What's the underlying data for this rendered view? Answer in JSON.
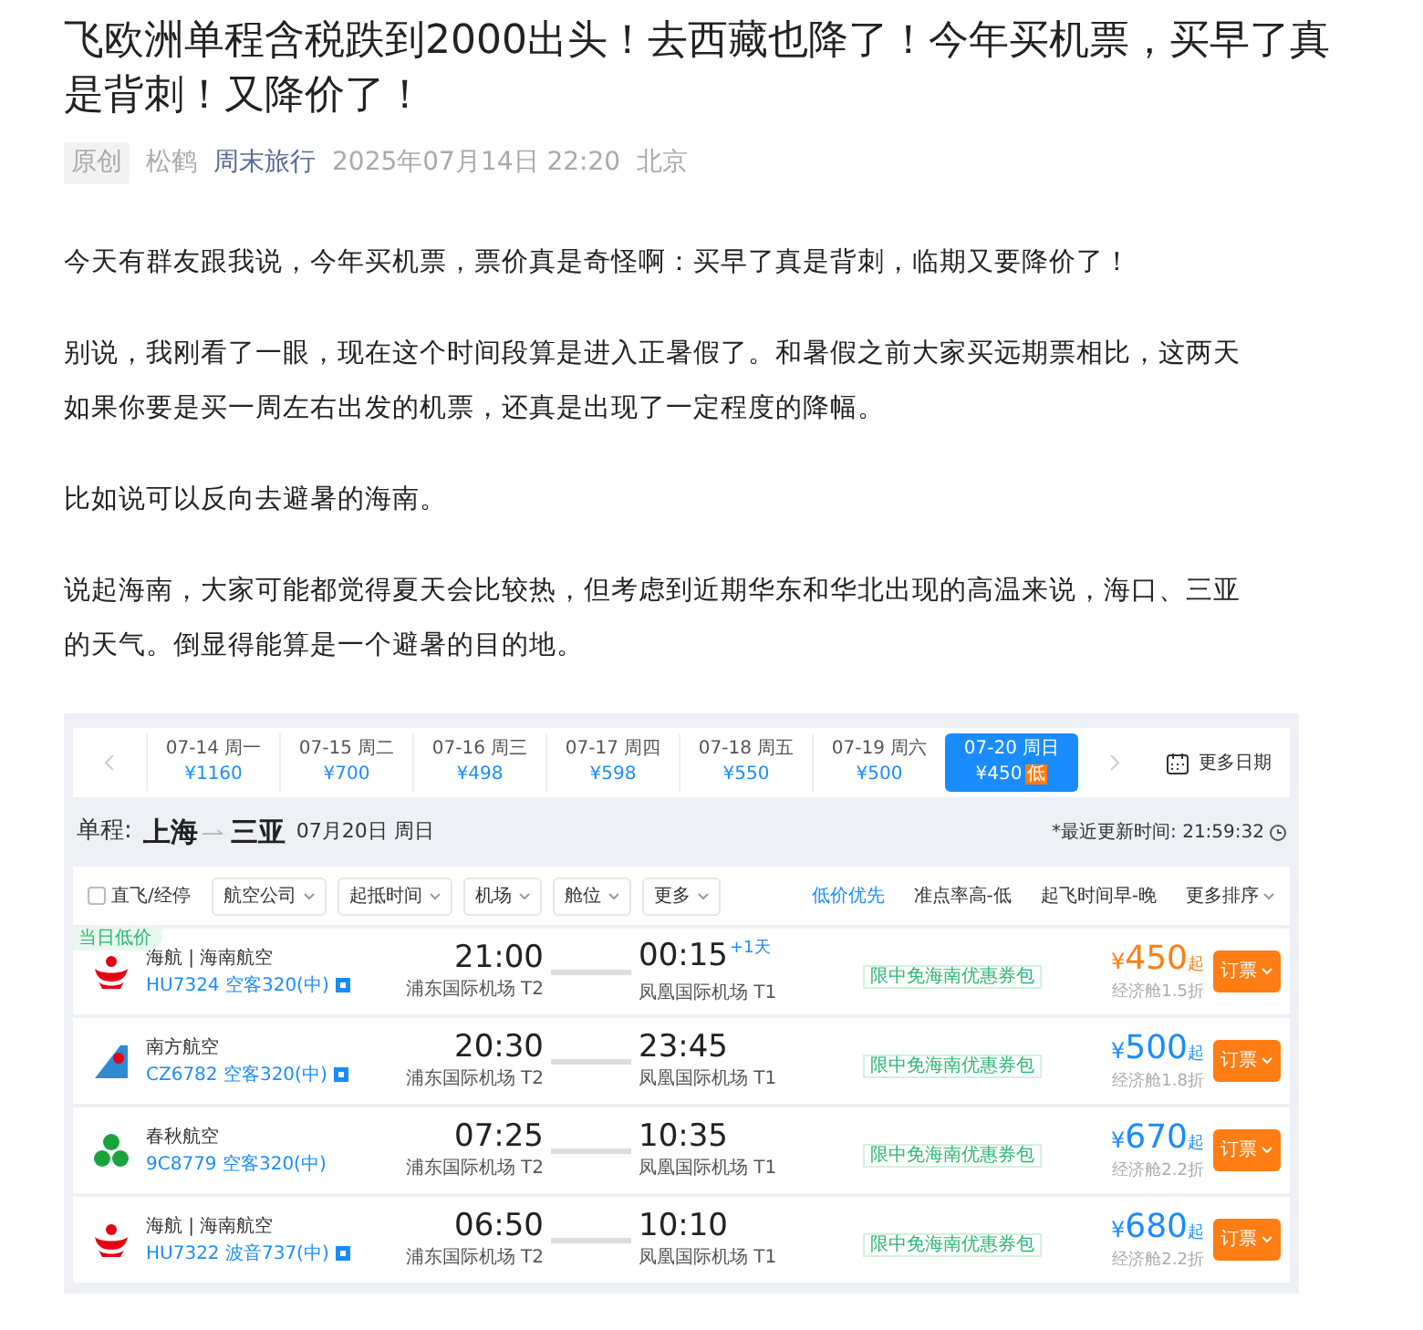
{
  "article": {
    "title": "飞欧洲单程含税跌到2000出头！去西藏也降了！今年买机票，买早了真是背刺！又降价了！",
    "meta": {
      "badge": "原创",
      "author": "松鹤",
      "column": "周末旅行",
      "datetime": "2025年07月14日 22:20",
      "location": "北京"
    },
    "paragraphs": [
      "今天有群友跟我说，今年买机票，票价真是奇怪啊：买早了真是背刺，临期又要降价了！",
      "别说，我刚看了一眼，现在这个时间段算是进入正暑假了。和暑假之前大家买远期票相比，这两天如果你要是买一周左右出发的机票，还真是出现了一定程度的降幅。",
      "比如说可以反向去避暑的海南。",
      "说起海南，大家可能都觉得夏天会比较热，但考虑到近期华东和华北出现的高温来说，海口、三亚的天气。倒显得能算是一个避暑的目的地。"
    ]
  },
  "flight_app": {
    "dates": [
      {
        "date": "07-14",
        "weekday": "周一",
        "price": "¥1160",
        "selected": false
      },
      {
        "date": "07-15",
        "weekday": "周二",
        "price": "¥700",
        "selected": false
      },
      {
        "date": "07-16",
        "weekday": "周三",
        "price": "¥498",
        "selected": false
      },
      {
        "date": "07-17",
        "weekday": "周四",
        "price": "¥598",
        "selected": false
      },
      {
        "date": "07-18",
        "weekday": "周五",
        "price": "¥550",
        "selected": false
      },
      {
        "date": "07-19",
        "weekday": "周六",
        "price": "¥500",
        "selected": false
      },
      {
        "date": "07-20",
        "weekday": "周日",
        "price": "¥450",
        "selected": true,
        "badge": "低"
      }
    ],
    "more_dates": "更多日期",
    "route": {
      "label": "单程:",
      "from": "上海",
      "to": "三亚",
      "date": "07月20日 周日",
      "updated": "*最近更新时间: 21:59:32"
    },
    "filters": [
      {
        "label": "直飞/经停",
        "kind": "checkbox",
        "checked": false
      },
      {
        "label": "航空公司",
        "kind": "dropdown"
      },
      {
        "label": "起抵时间",
        "kind": "dropdown"
      },
      {
        "label": "机场",
        "kind": "dropdown"
      },
      {
        "label": "舱位",
        "kind": "dropdown"
      },
      {
        "label": "更多",
        "kind": "dropdown"
      }
    ],
    "sorts": [
      {
        "label": "低价优先",
        "selected": true,
        "kind": "plain"
      },
      {
        "label": "准点率高-低",
        "selected": false,
        "kind": "plain"
      },
      {
        "label": "起飞时间早-晚",
        "selected": false,
        "kind": "plain"
      },
      {
        "label": "更多排序",
        "selected": false,
        "kind": "dropdown"
      }
    ],
    "flights": [
      {
        "tag": "当日低价",
        "kind": "hainan",
        "airline": "海航 | 海南航空",
        "flight": "HU7324 空客320(中)",
        "fare_icon": true,
        "depart_time": "21:00",
        "depart_airport": "浦东国际机场 T2",
        "arrive_time": "00:15",
        "next_day": "+1天",
        "arrive_airport": "凤凰国际机场 T1",
        "promo": "限中免海南优惠券包",
        "currency": "¥",
        "price": "450",
        "price_suffix": "起",
        "color": "#ff7d13",
        "cabin": "经济舱1.5折",
        "button": "订票"
      },
      {
        "kind": "southern",
        "airline": "南方航空",
        "flight": "CZ6782 空客320(中)",
        "fare_icon": true,
        "depart_time": "20:30",
        "depart_airport": "浦东国际机场 T2",
        "arrive_time": "23:45",
        "arrive_airport": "凤凰国际机场 T1",
        "promo": "限中免海南优惠券包",
        "currency": "¥",
        "price": "500",
        "price_suffix": "起",
        "color": "#1a8cff",
        "cabin": "经济舱1.8折",
        "button": "订票"
      },
      {
        "kind": "spring",
        "airline": "春秋航空",
        "flight": "9C8779 空客320(中)",
        "fare_icon": false,
        "depart_time": "07:25",
        "depart_airport": "浦东国际机场 T2",
        "arrive_time": "10:35",
        "arrive_airport": "凤凰国际机场 T1",
        "promo": "限中免海南优惠券包",
        "currency": "¥",
        "price": "670",
        "price_suffix": "起",
        "color": "#1a8cff",
        "cabin": "经济舱2.2折",
        "button": "订票"
      },
      {
        "kind": "hainan",
        "airline": "海航 | 海南航空",
        "flight": "HU7322 波音737(中)",
        "fare_icon": true,
        "depart_time": "06:50",
        "depart_airport": "浦东国际机场 T2",
        "arrive_time": "10:10",
        "arrive_airport": "凤凰国际机场 T1",
        "promo": "限中免海南优惠券包",
        "currency": "¥",
        "price": "680",
        "price_suffix": "起",
        "color": "#1a8cff",
        "cabin": "经济舱2.2折",
        "button": "订票"
      }
    ]
  }
}
